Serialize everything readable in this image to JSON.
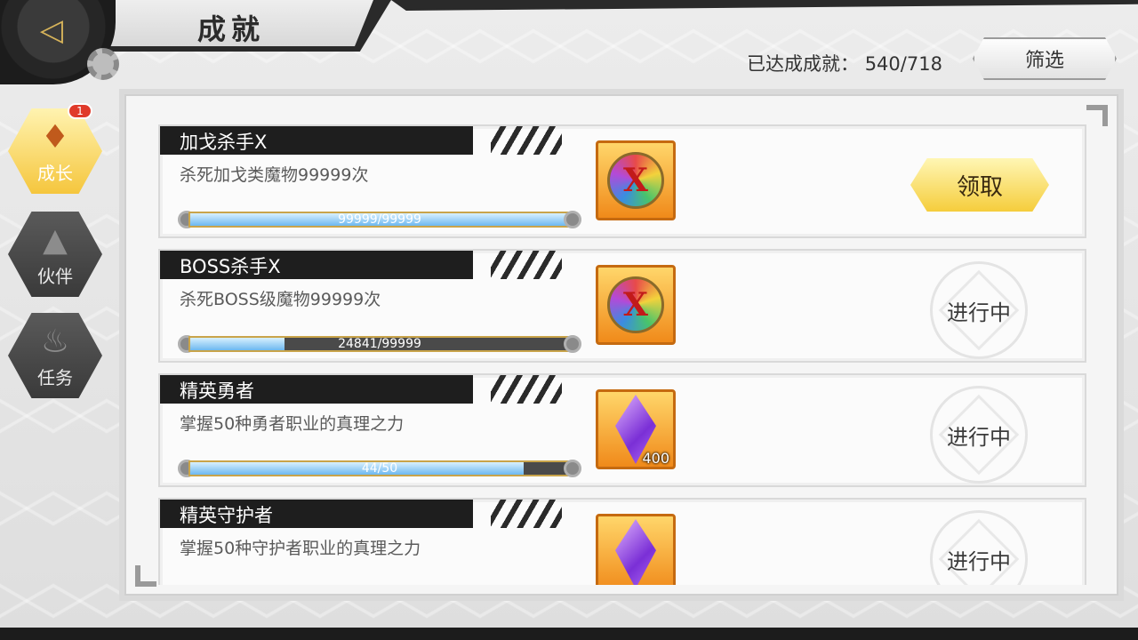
{
  "header": {
    "title": "成就",
    "achieved_label": "已达成成就：",
    "achieved_value": "540/718",
    "filter_label": "筛选"
  },
  "tabs": [
    {
      "label": "成长",
      "icon": "hooded-figure-icon",
      "active": true,
      "badge": "1"
    },
    {
      "label": "伙伴",
      "icon": "partner-silhouette-icon",
      "active": false
    },
    {
      "label": "任务",
      "icon": "quest-book-icon",
      "active": false
    }
  ],
  "achievements": [
    {
      "title": "加戈杀手X",
      "desc": "杀死加戈类魔物99999次",
      "progress_text": "99999/99999",
      "progress": 1.0,
      "reward": "rainbow-coin-x",
      "reward_count": "",
      "status": "领取",
      "claimable": true
    },
    {
      "title": "BOSS杀手X",
      "desc": "杀死BOSS级魔物99999次",
      "progress_text": "24841/99999",
      "progress": 0.2484,
      "reward": "rainbow-coin-x",
      "reward_count": "",
      "status": "进行中",
      "claimable": false
    },
    {
      "title": "精英勇者",
      "desc": "掌握50种勇者职业的真理之力",
      "progress_text": "44/50",
      "progress": 0.88,
      "reward": "purple-crystal",
      "reward_count": "400",
      "status": "进行中",
      "claimable": false
    },
    {
      "title": "精英守护者",
      "desc": "掌握50种守护者职业的真理之力",
      "progress_text": "",
      "progress": null,
      "reward": "purple-crystal",
      "reward_count": "",
      "status": "进行中",
      "claimable": false
    }
  ],
  "coin_letter": "X"
}
